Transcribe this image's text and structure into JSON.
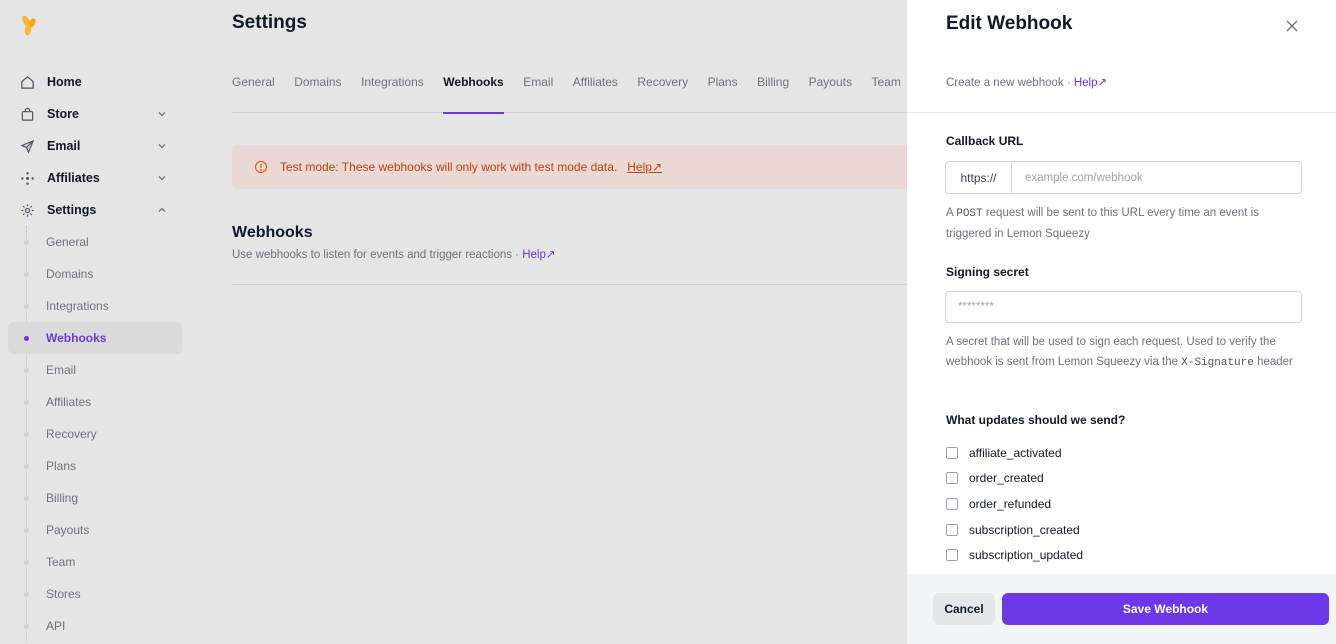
{
  "sidebar": {
    "logo_icon": "lemon-squeezy-logo",
    "items": [
      {
        "label": "Home",
        "icon": "home-icon"
      },
      {
        "label": "Store",
        "icon": "bag-icon"
      },
      {
        "label": "Email",
        "icon": "send-icon"
      },
      {
        "label": "Affiliates",
        "icon": "network-icon"
      },
      {
        "label": "Settings",
        "icon": "gear-icon"
      }
    ],
    "sub_items": [
      "General",
      "Domains",
      "Integrations",
      "Webhooks",
      "Email",
      "Affiliates",
      "Recovery",
      "Plans",
      "Billing",
      "Payouts",
      "Team",
      "Stores",
      "API"
    ],
    "active_sub": "Webhooks"
  },
  "main": {
    "title": "Settings",
    "tabs": [
      "General",
      "Domains",
      "Integrations",
      "Webhooks",
      "Email",
      "Affiliates",
      "Recovery",
      "Plans",
      "Billing",
      "Payouts",
      "Team"
    ],
    "active_tab": "Webhooks",
    "banner": {
      "text": "Test mode: These webhooks will only work with test mode data.",
      "link": "Help↗"
    },
    "section": {
      "title": "Webhooks",
      "subtitle": "Use webhooks to listen for events and trigger reactions · ",
      "link": "Help↗"
    }
  },
  "panel": {
    "title": "Edit Webhook",
    "subtitle": "Create a new webhook · ",
    "subtitle_link": "Help↗",
    "callback": {
      "label": "Callback URL",
      "prefix": "https://",
      "placeholder": "example.com/webhook",
      "help_before": "A ",
      "help_code": "POST",
      "help_after": " request will be sent to this URL every time an event is triggered in Lemon Squeezy"
    },
    "secret": {
      "label": "Signing secret",
      "placeholder": "********",
      "help_before": "A secret that will be used to sign each request. Used to verify the webhook is sent from Lemon Squeezy via the ",
      "help_code": "X-Signature",
      "help_after": " header"
    },
    "updates": {
      "label": "What updates should we send?",
      "options": [
        "affiliate_activated",
        "order_created",
        "order_refunded",
        "subscription_created",
        "subscription_updated"
      ]
    },
    "cancel_label": "Cancel",
    "save_label": "Save Webhook"
  },
  "colors": {
    "accent": "#6d38e8",
    "warning": "#c2410c",
    "banner_bg": "#ead8d4"
  }
}
